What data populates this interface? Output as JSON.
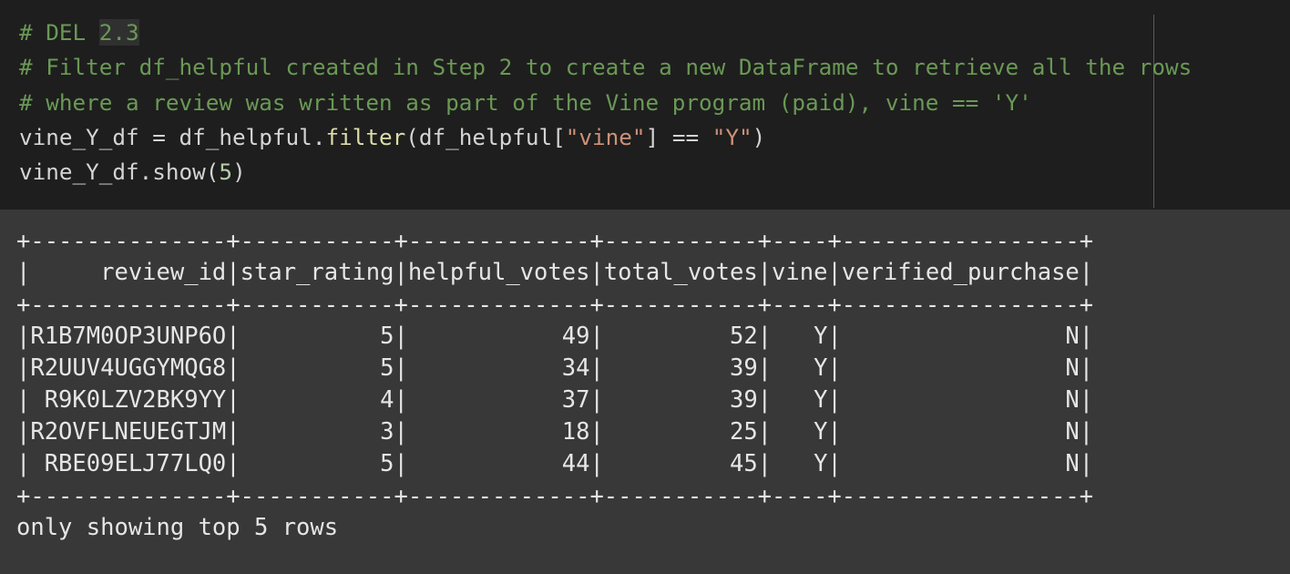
{
  "code": {
    "comment_1_prefix": "# DEL ",
    "comment_1_highlight": "2.3",
    "comment_2": "# Filter df_helpful created in Step 2 to create a new DataFrame to retrieve all the rows",
    "comment_3": "# where a review was written as part of the Vine program (paid), vine == 'Y'",
    "line_4": {
      "part1": "vine_Y_df = df_helpful.",
      "func": "filter",
      "part2": "(df_helpful[",
      "str1": "\"vine\"",
      "part3": "] == ",
      "str2": "\"Y\"",
      "part4": ")"
    },
    "line_5": {
      "part1": "vine_Y_df.show(",
      "num": "5",
      "part2": ")"
    }
  },
  "output": {
    "border": "+--------------+-----------+-------------+-----------+----+-----------------+",
    "header_row": "|     review_id|star_rating|helpful_votes|total_votes|vine|verified_purchase|",
    "columns": [
      "review_id",
      "star_rating",
      "helpful_votes",
      "total_votes",
      "vine",
      "verified_purchase"
    ],
    "rows": [
      "|R1B7M0OP3UNP6O|          5|           49|         52|   Y|                N|",
      "|R2UUV4UGGYMQG8|          5|           34|         39|   Y|                N|",
      "| R9K0LZV2BK9YY|          4|           37|         39|   Y|                N|",
      "|R2OVFLNEUEGTJM|          3|           18|         25|   Y|                N|",
      "| RBE09ELJ77LQ0|          5|           44|         45|   Y|                N|"
    ],
    "footer": "only showing top 5 rows"
  },
  "colors": {
    "editor_bg": "#1e1e1e",
    "output_bg": "#383838",
    "comment": "#6a9955",
    "string": "#ce9178",
    "function": "#dcdcaa",
    "number": "#b5cea8"
  }
}
